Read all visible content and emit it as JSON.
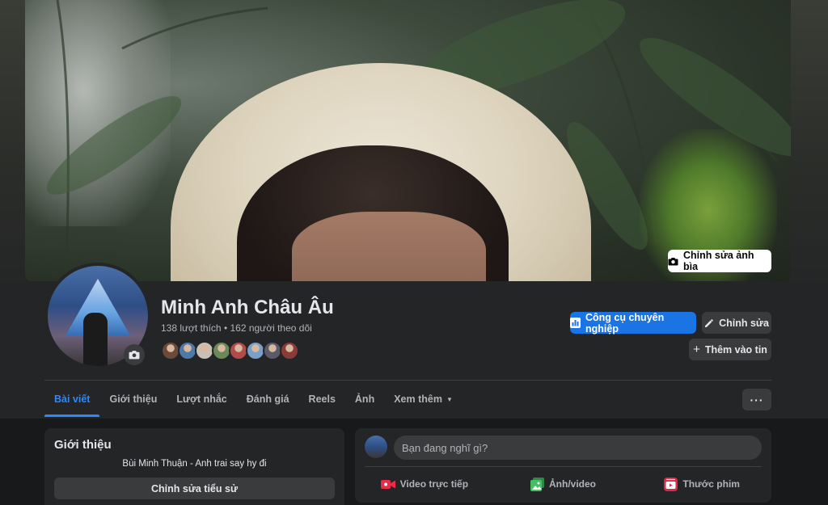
{
  "cover": {
    "edit_label": "Chỉnh sửa ảnh bìa"
  },
  "profile": {
    "name": "Minh Anh Châu Âu",
    "stats": "138 lượt thích • 162 người theo dõi",
    "friend_avatar_colors": [
      "#6b4a3a",
      "#4d7aa6",
      "#c9c0b5",
      "#6b8a5a",
      "#b34b4b",
      "#7aa0c9",
      "#5a5a6a",
      "#8a3a3a"
    ]
  },
  "actions": {
    "pro_tools_label": "Công cụ chuyên nghiệp",
    "edit_label": "Chỉnh sửa",
    "add_story_label": "Thêm vào tin"
  },
  "tabs": [
    {
      "label": "Bài viết",
      "active": true
    },
    {
      "label": "Giới thiệu",
      "active": false
    },
    {
      "label": "Lượt nhắc",
      "active": false
    },
    {
      "label": "Đánh giá",
      "active": false
    },
    {
      "label": "Reels",
      "active": false
    },
    {
      "label": "Ảnh",
      "active": false
    },
    {
      "label": "Xem thêm",
      "active": false
    }
  ],
  "intro": {
    "title": "Giới thiệu",
    "bio": "Bùi Minh Thuận - Anh trai say hy đi",
    "edit_bio_label": "Chỉnh sửa tiểu sử"
  },
  "composer": {
    "placeholder": "Bạn đang nghĩ gì?",
    "live_label": "Video trực tiếp",
    "photo_label": "Ảnh/video",
    "reel_label": "Thước phim"
  },
  "colors": {
    "accent": "#1b74e4",
    "active_tab": "#2d88ff",
    "live_red": "#f02849",
    "photo_green": "#45bd62",
    "reel_pink": "#e42645"
  }
}
